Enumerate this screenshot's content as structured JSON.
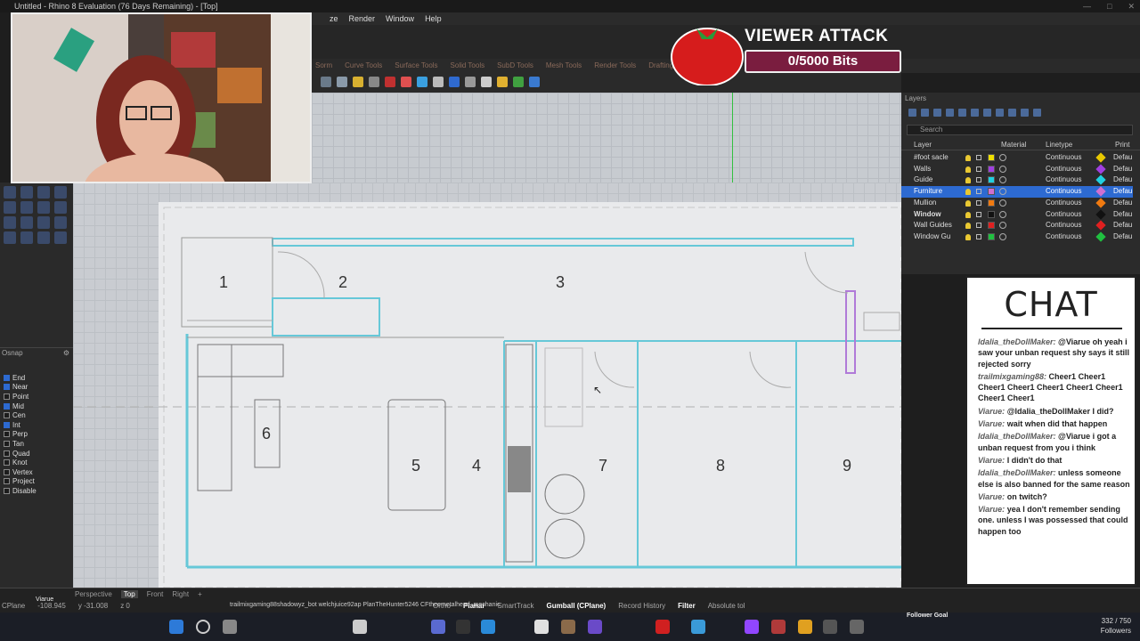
{
  "app": {
    "title": "Untitled - Rhino 8 Evaluation (76 Days Remaining) - [Top]"
  },
  "menu": [
    "ze",
    "Render",
    "Window",
    "Help"
  ],
  "toolbar_tabs": [
    "Sorm",
    "Curve Tools",
    "Surface Tools",
    "Solid Tools",
    "SubD Tools",
    "Mesh Tools",
    "Render Tools",
    "Drafting",
    "Ne"
  ],
  "osnap": {
    "title": "Osnap",
    "items": [
      {
        "label": "End",
        "checked": true
      },
      {
        "label": "Near",
        "checked": true
      },
      {
        "label": "Point",
        "checked": false
      },
      {
        "label": "Mid",
        "checked": true
      },
      {
        "label": "Cen",
        "checked": false
      },
      {
        "label": "Int",
        "checked": true
      },
      {
        "label": "Perp",
        "checked": false
      },
      {
        "label": "Tan",
        "checked": false
      },
      {
        "label": "Quad",
        "checked": false
      },
      {
        "label": "Knot",
        "checked": false
      },
      {
        "label": "Vertex",
        "checked": false
      },
      {
        "label": "Project",
        "checked": false
      },
      {
        "label": "Disable",
        "checked": false
      }
    ]
  },
  "layers": {
    "title": "Layers",
    "search_placeholder": "Search",
    "headers": {
      "layer": "Layer",
      "material": "Material",
      "linetype": "Linetype",
      "print": "Print"
    },
    "rows": [
      {
        "name": "#foot sacle",
        "color": "#f0e000",
        "linetype": "Continuous",
        "print_color": "#e8c800",
        "print": "Defau",
        "selected": false
      },
      {
        "name": "Walls",
        "color": "#a040e0",
        "linetype": "Continuous",
        "print_color": "#a040e0",
        "print": "Defau",
        "selected": false
      },
      {
        "name": "Guide",
        "color": "#20d0e0",
        "linetype": "Continuous",
        "print_color": "#20d0e0",
        "print": "Defau",
        "selected": false
      },
      {
        "name": "Furniture",
        "color": "#d070d0",
        "linetype": "Continuous",
        "print_color": "#d070d0",
        "print": "Defau",
        "selected": true
      },
      {
        "name": "Mullion",
        "color": "#f07a10",
        "linetype": "Continuous",
        "print_color": "#f07a10",
        "print": "Defau",
        "selected": false
      },
      {
        "name": "Window",
        "color": "#111111",
        "linetype": "Continuous",
        "print_color": "#111111",
        "print": "Defau",
        "selected": false,
        "current": true
      },
      {
        "name": "Wall Guides",
        "color": "#e02020",
        "linetype": "Continuous",
        "print_color": "#e02020",
        "print": "Defau",
        "selected": false
      },
      {
        "name": "Window Gu",
        "color": "#20c040",
        "linetype": "Continuous",
        "print_color": "#20c040",
        "print": "Defau",
        "selected": false
      }
    ]
  },
  "plan": {
    "room_numbers": [
      "1",
      "2",
      "3",
      "6",
      "5",
      "4",
      "7",
      "8",
      "9"
    ]
  },
  "alert": {
    "title": "VIEWER ATTACK",
    "bits": "0/5000 Bits"
  },
  "chat": {
    "title": "CHAT",
    "messages": [
      {
        "user": "ldalia_theDollMaker:",
        "text": "@Viarue oh yeah i saw your unban request shy says it still rejected sorry"
      },
      {
        "user": "trailmixgaming88:",
        "text": "Cheer1 Cheer1 Cheer1 Cheer1 Cheer1 Cheer1 Cheer1 Cheer1 Cheer1"
      },
      {
        "user": "Viarue:",
        "text": "@ldalia_theDollMaker I did?"
      },
      {
        "user": "Viarue:",
        "text": "wait when did that happen"
      },
      {
        "user": "ldalia_theDollMaker:",
        "text": "@Viarue i got a unban request from you i think"
      },
      {
        "user": "Viarue:",
        "text": "I didn't do that"
      },
      {
        "user": "ldalia_theDollMaker:",
        "text": "unless someone else is also banned for the same reason"
      },
      {
        "user": "Viarue:",
        "text": "on twitch?"
      },
      {
        "user": "Viarue:",
        "text": "yea I don't remember sending one. unless I was possessed that could happen too"
      }
    ]
  },
  "viewport_tabs": [
    "Perspective",
    "Top",
    "Front",
    "Right"
  ],
  "status": {
    "cplane": "CPlane",
    "x": "-108.945",
    "y": "y -31.008",
    "z": "z 0",
    "items": [
      "Ortho",
      "Planar",
      "SmartTrack",
      "Gumball (CPlane)",
      "Record History",
      "Filter",
      "Absolute tol"
    ],
    "overlay": "trailmixgaming88shadowyz_bot   welchjuice92ap   PlanTheHunter5246   CFtheemetalhead_mechanic"
  },
  "goal": "Follower Goal",
  "followers": {
    "count": "332 / 750",
    "label": "Followers"
  },
  "webcam_label": "Viarue"
}
